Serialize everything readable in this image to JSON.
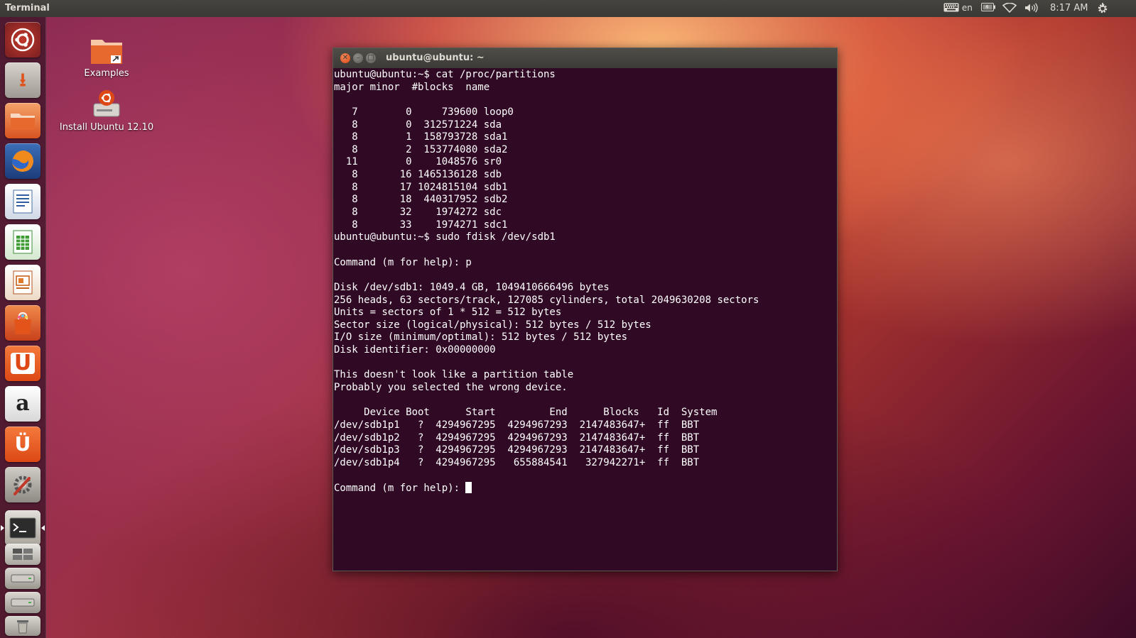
{
  "top_panel": {
    "app_title": "Terminal",
    "keyboard_layout": "en",
    "clock": "8:17 AM",
    "icons": [
      "keyboard-icon",
      "battery-icon",
      "wifi-icon",
      "volume-icon",
      "settings-gear-icon"
    ]
  },
  "launcher": {
    "items": [
      {
        "name": "dash-home",
        "icon": "ubuntu-logo-icon"
      },
      {
        "name": "install-ubuntu",
        "icon": "installer-icon"
      },
      {
        "name": "files",
        "icon": "folder-icon"
      },
      {
        "name": "firefox",
        "icon": "firefox-icon"
      },
      {
        "name": "libreoffice-writer",
        "icon": "writer-icon"
      },
      {
        "name": "libreoffice-calc",
        "icon": "calc-icon"
      },
      {
        "name": "libreoffice-impress",
        "icon": "impress-icon"
      },
      {
        "name": "software-center",
        "icon": "shopping-bag-icon"
      },
      {
        "name": "ubuntu-one",
        "icon": "ubuntu-one-icon"
      },
      {
        "name": "amazon",
        "icon": "amazon-icon"
      },
      {
        "name": "ubuntu-one-music",
        "icon": "music-store-icon"
      },
      {
        "name": "system-settings",
        "icon": "settings-icon"
      },
      {
        "name": "terminal",
        "icon": "terminal-icon"
      },
      {
        "name": "workspaces",
        "icon": "workspace-icon"
      },
      {
        "name": "drive-1",
        "icon": "drive-icon"
      },
      {
        "name": "drive-2",
        "icon": "drive-icon"
      },
      {
        "name": "trash",
        "icon": "trash-icon"
      }
    ]
  },
  "desktop": {
    "icons": [
      {
        "label": "Examples",
        "icon": "folder-link-icon"
      },
      {
        "label": "Install Ubuntu 12.10",
        "icon": "installer-icon"
      }
    ]
  },
  "terminal_window": {
    "title": "ubuntu@ubuntu: ~",
    "lines": [
      "ubuntu@ubuntu:~$ cat /proc/partitions",
      "major minor  #blocks  name",
      "",
      "   7        0     739600 loop0",
      "   8        0  312571224 sda",
      "   8        1  158793728 sda1",
      "   8        2  153774080 sda2",
      "  11        0    1048576 sr0",
      "   8       16 1465136128 sdb",
      "   8       17 1024815104 sdb1",
      "   8       18  440317952 sdb2",
      "   8       32    1974272 sdc",
      "   8       33    1974271 sdc1",
      "ubuntu@ubuntu:~$ sudo fdisk /dev/sdb1",
      "",
      "Command (m for help): p",
      "",
      "Disk /dev/sdb1: 1049.4 GB, 1049410666496 bytes",
      "256 heads, 63 sectors/track, 127085 cylinders, total 2049630208 sectors",
      "Units = sectors of 1 * 512 = 512 bytes",
      "Sector size (logical/physical): 512 bytes / 512 bytes",
      "I/O size (minimum/optimal): 512 bytes / 512 bytes",
      "Disk identifier: 0x00000000",
      "",
      "This doesn't look like a partition table",
      "Probably you selected the wrong device.",
      "",
      "     Device Boot      Start         End      Blocks   Id  System",
      "/dev/sdb1p1   ?  4294967295  4294967293  2147483647+  ff  BBT",
      "/dev/sdb1p2   ?  4294967295  4294967293  2147483647+  ff  BBT",
      "/dev/sdb1p3   ?  4294967295  4294967293  2147483647+  ff  BBT",
      "/dev/sdb1p4   ?  4294967295   655884541   327942271+  ff  BBT",
      ""
    ],
    "prompt_line": "Command (m for help): "
  },
  "colors": {
    "terminal_bg": "#300a24",
    "panel_bg": "#3c3b37",
    "accent_orange": "#dd4814"
  }
}
